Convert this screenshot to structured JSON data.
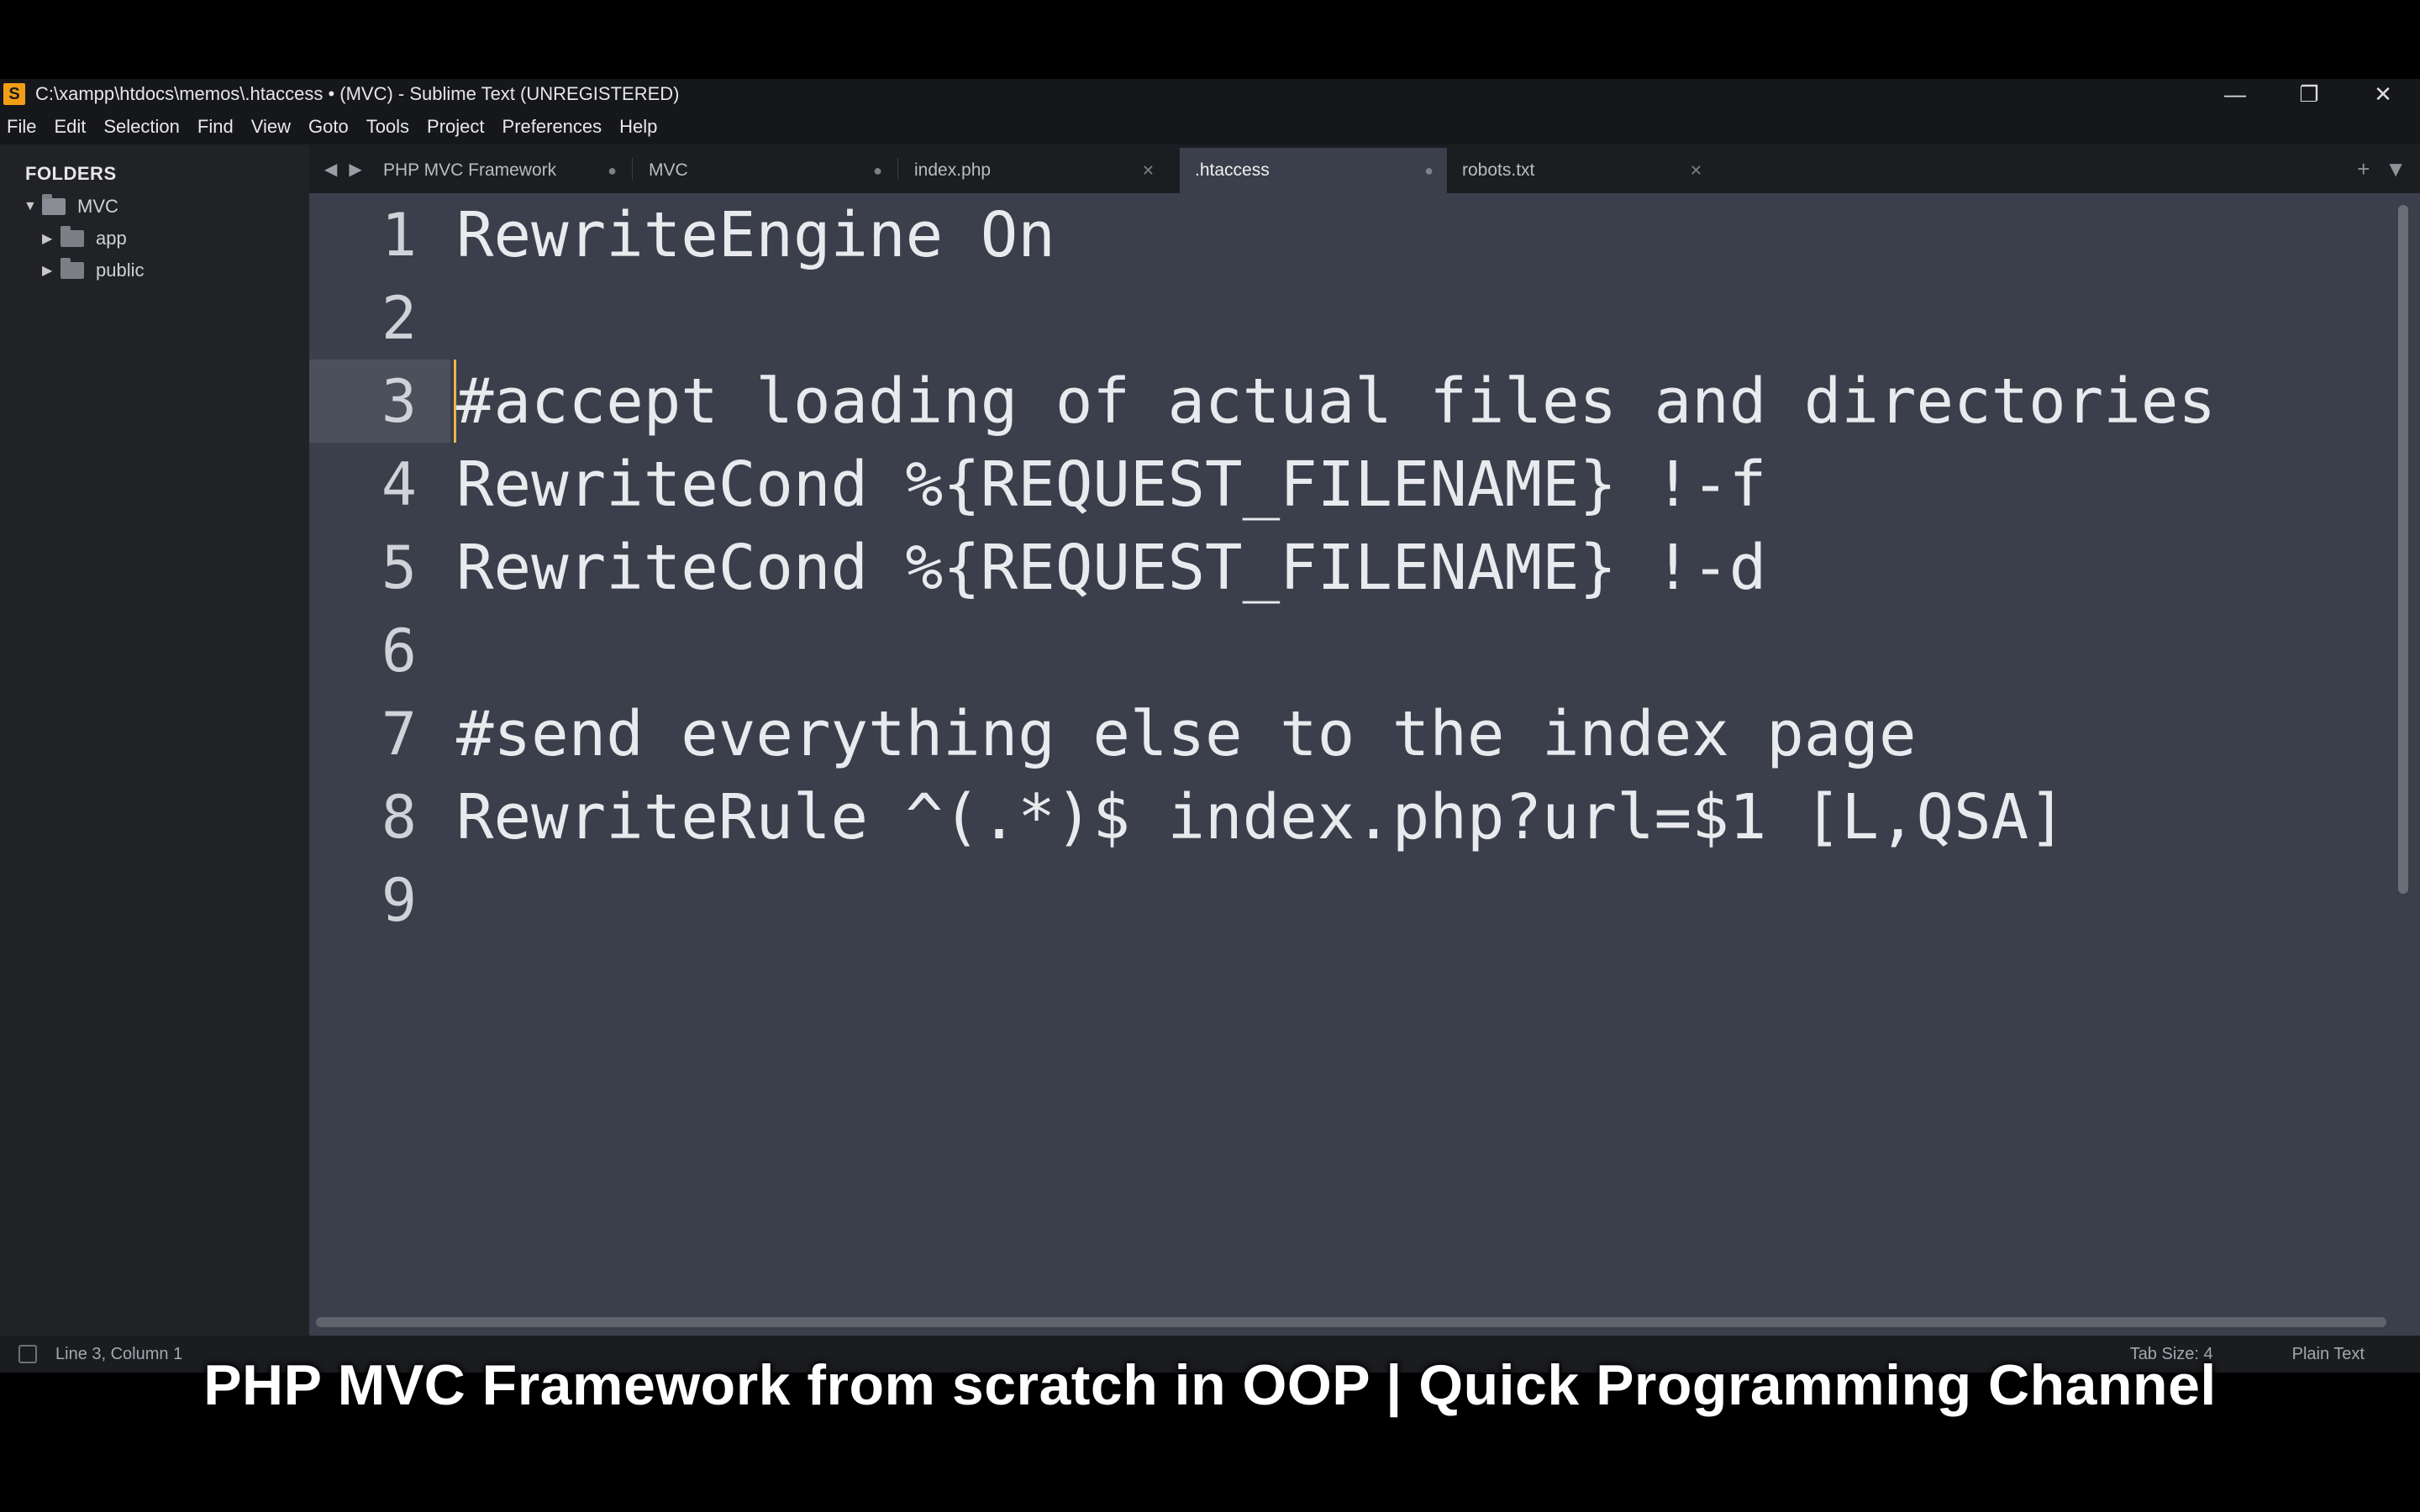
{
  "window": {
    "app_icon": "S",
    "title": "C:\\xampp\\htdocs\\memos\\.htaccess • (MVC) - Sublime Text (UNREGISTERED)",
    "controls": {
      "minimize": "—",
      "restore": "❐",
      "close": "✕"
    }
  },
  "menu": [
    "File",
    "Edit",
    "Selection",
    "Find",
    "View",
    "Goto",
    "Tools",
    "Project",
    "Preferences",
    "Help"
  ],
  "sidebar": {
    "heading": "FOLDERS",
    "root": "MVC",
    "children": [
      "app",
      "public"
    ]
  },
  "tabs": [
    {
      "label": "PHP MVC Framework",
      "mark": "●",
      "active": false
    },
    {
      "label": "MVC",
      "mark": "●",
      "active": false
    },
    {
      "label": "index.php",
      "mark": "✕",
      "active": false
    },
    {
      "label": ".htaccess",
      "mark": "●",
      "active": true
    },
    {
      "label": "robots.txt",
      "mark": "✕",
      "active": false
    }
  ],
  "tab_nav": {
    "prev": "◀",
    "next": "▶"
  },
  "tab_actions": {
    "new": "+",
    "menu": "▼"
  },
  "editor": {
    "current_line": 3,
    "lines": [
      {
        "num": "1",
        "text": "RewriteEngine On"
      },
      {
        "num": "2",
        "text": ""
      },
      {
        "num": "3",
        "text": "#accept loading of actual files and directories"
      },
      {
        "num": "4",
        "text": "RewriteCond %{REQUEST_FILENAME} !-f"
      },
      {
        "num": "5",
        "text": "RewriteCond %{REQUEST_FILENAME} !-d"
      },
      {
        "num": "6",
        "text": ""
      },
      {
        "num": "7",
        "text": "#send everything else to the index page"
      },
      {
        "num": "8",
        "text": "RewriteRule ^(.*)$ index.php?url=$1 [L,QSA]"
      },
      {
        "num": "9",
        "text": ""
      }
    ]
  },
  "status": {
    "position": "Line 3, Column 1",
    "tab_size": "Tab Size: 4",
    "syntax": "Plain Text"
  },
  "caption": "PHP MVC Framework from scratch in OOP | Quick Programming Channel"
}
